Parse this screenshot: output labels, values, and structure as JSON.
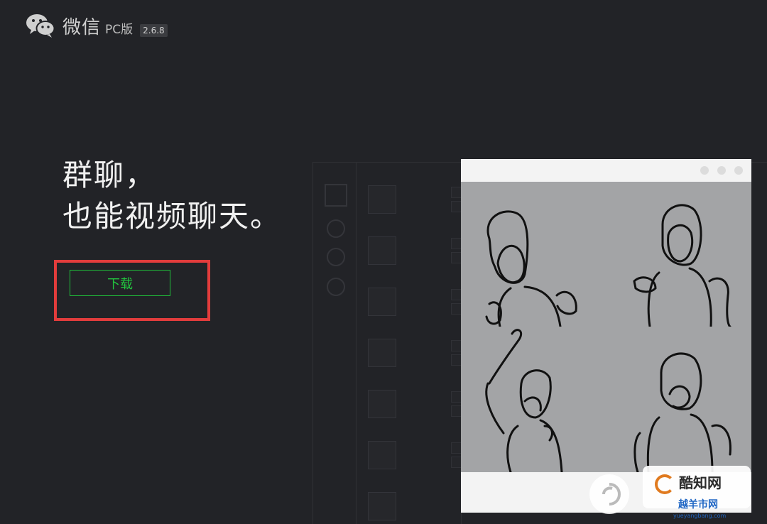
{
  "header": {
    "logo_icon": "wechat-logo-icon",
    "app_name": "微信",
    "edition": "PC版",
    "version": "2.6.8"
  },
  "hero": {
    "line1": "群聊，",
    "line2": "也能视频聊天。",
    "download_label": "下载"
  },
  "colors": {
    "background": "#222327",
    "accent_green": "#22c43e",
    "highlight_red": "#e23c3c"
  },
  "watermark": {
    "text1": "酷知网",
    "text2": "越羊市网",
    "text3": "yueyangbang.com"
  }
}
